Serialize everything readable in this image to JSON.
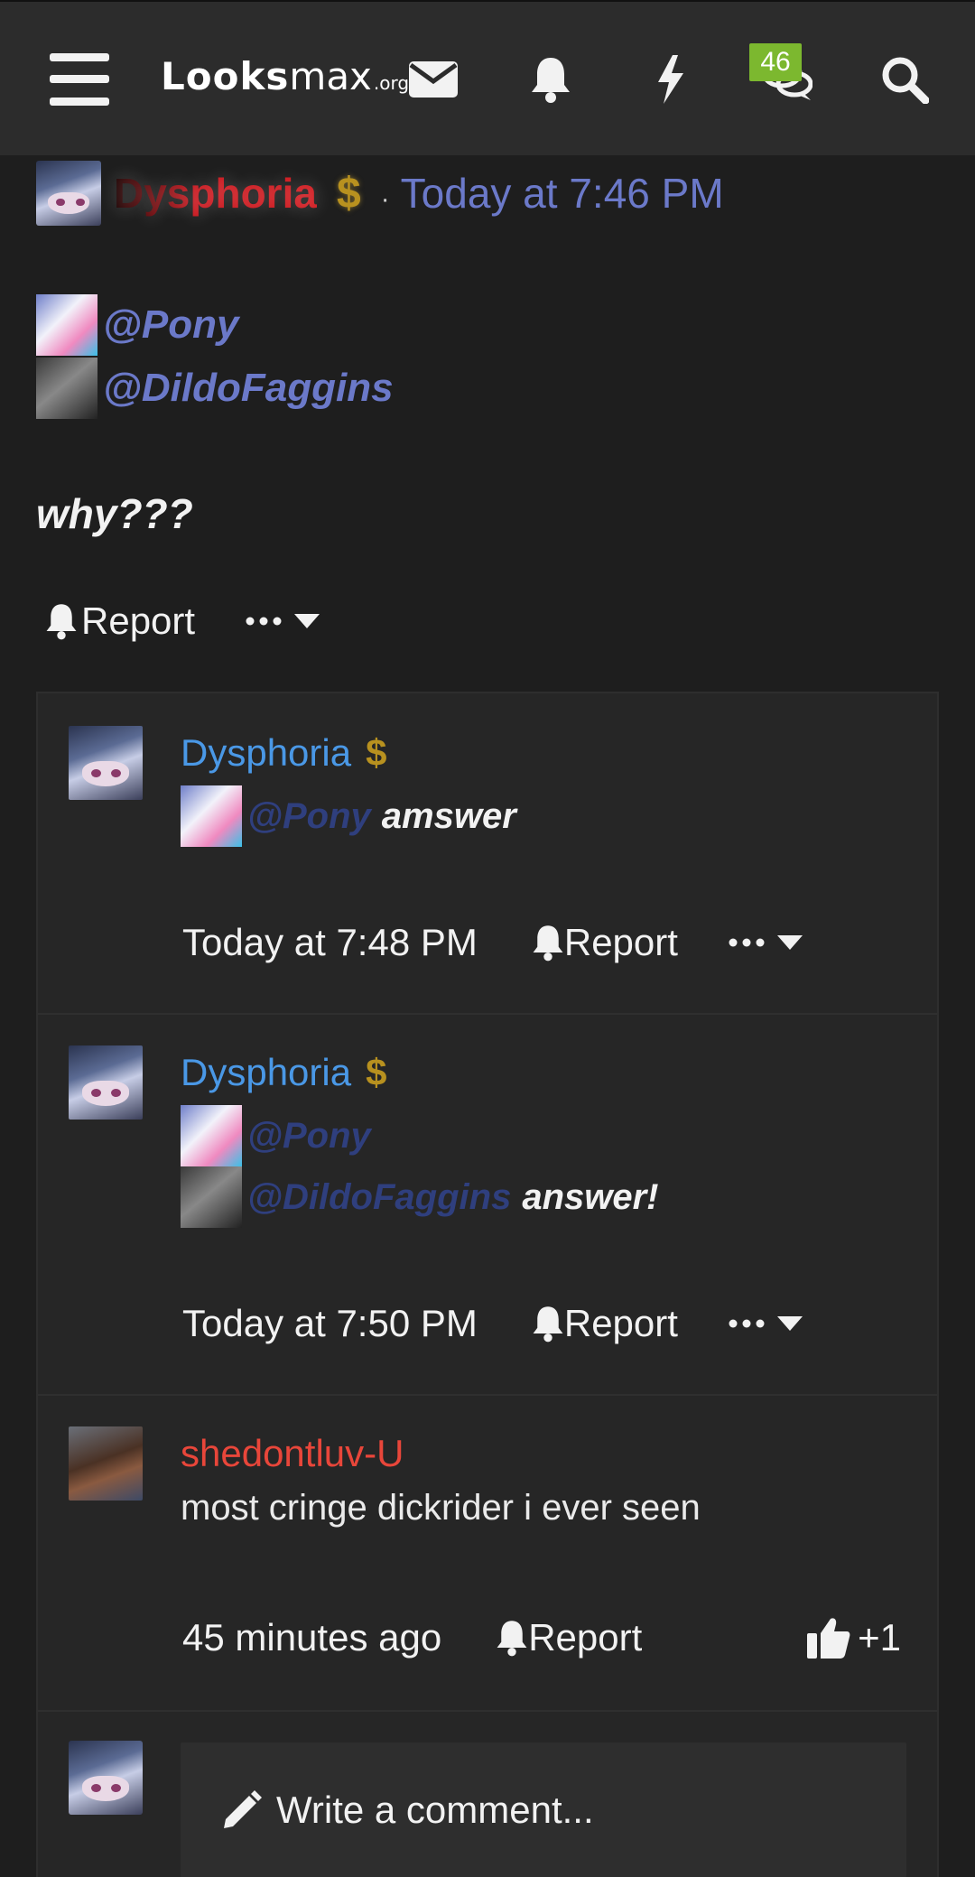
{
  "nav": {
    "logo_main": "Looks",
    "logo_max": "max",
    "logo_org": ".org",
    "messages_badge": "46"
  },
  "post": {
    "author": "Dysphoria",
    "author_badge": "$",
    "separator": "·",
    "time": "Today at 7:46 PM",
    "mentions": [
      "@Pony",
      "@DildoFaggins"
    ],
    "body": "why???",
    "report_label": "Report"
  },
  "comments": [
    {
      "author": "Dysphoria",
      "badge": "$",
      "mentions": [
        "@Pony"
      ],
      "text": "amswer",
      "time": "Today at 7:48 PM",
      "report_label": "Report"
    },
    {
      "author": "Dysphoria",
      "badge": "$",
      "mentions": [
        "@Pony",
        "@DildoFaggins"
      ],
      "text": "answer!",
      "time": "Today at 7:50 PM",
      "report_label": "Report"
    },
    {
      "author": "shedontluv-U",
      "text": "most cringe dickrider i ever seen",
      "time": "45 minutes ago",
      "report_label": "Report",
      "likes": "+1"
    }
  ],
  "composer": {
    "placeholder": "Write a comment..."
  },
  "colors": {
    "link": "#6b79c9",
    "comment_author": "#4a98e6",
    "commenter_red": "#e8463a",
    "badge_green": "#7cb82f",
    "gold": "#b8911f"
  }
}
